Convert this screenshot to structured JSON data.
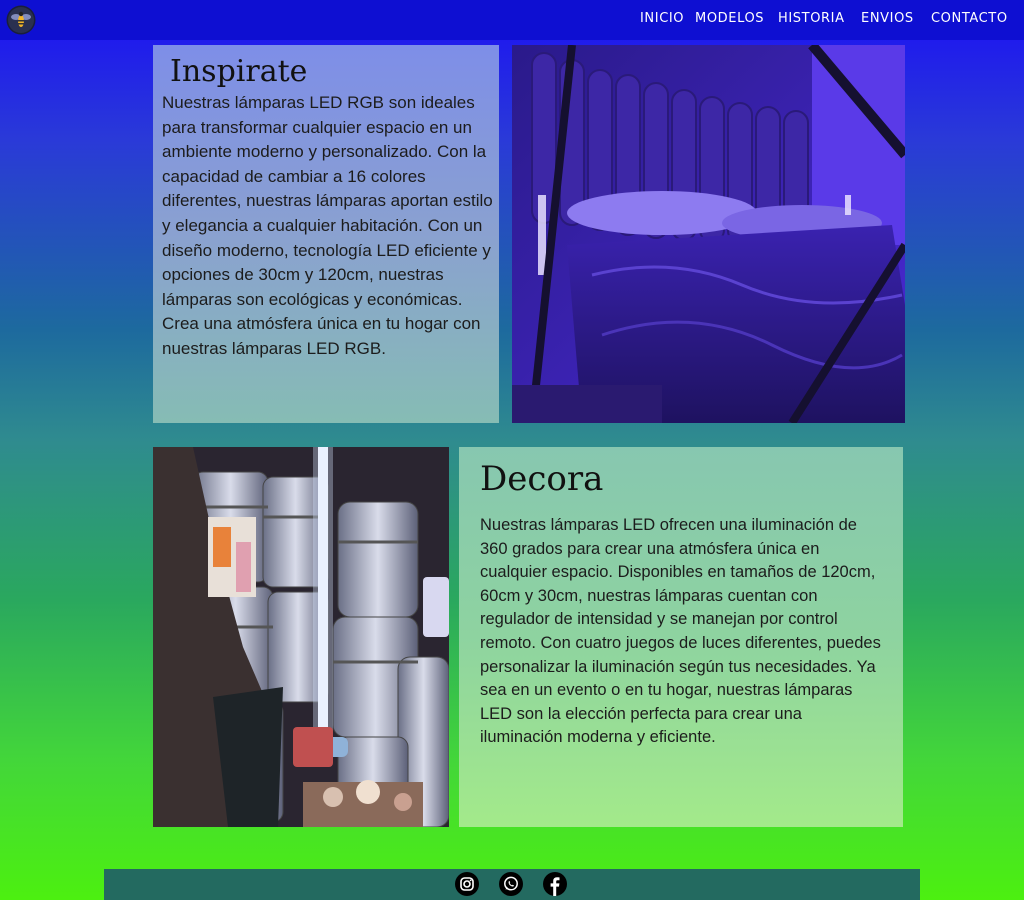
{
  "nav": {
    "logo_icon": "firefly-logo-icon",
    "items": [
      {
        "label": "INICIO"
      },
      {
        "label": "MODELOS"
      },
      {
        "label": "HISTORIA"
      },
      {
        "label": "ENVIOS"
      },
      {
        "label": "CONTACTO"
      }
    ]
  },
  "inspirate": {
    "title": "Inspirate",
    "body": "Nuestras lámparas LED RGB son ideales para transformar cualquier espacio en un ambiente moderno y personalizado. Con la capacidad de cambiar a 16 colores diferentes, nuestras lámparas aportan estilo y elegancia a cualquier habitación. Con un diseño moderno, tecnología LED eficiente y opciones de 30cm y 120cm, nuestras lámparas son ecológicas y económicas. Crea una atmósfera única en tu hogar con nuestras lámparas LED RGB."
  },
  "decora": {
    "title": "Decora",
    "body": "Nuestras lámparas LED ofrecen una iluminación de 360 grados para crear una atmósfera única en cualquier espacio. Disponibles en tamaños de 120cm, 60cm y 30cm, nuestras lámparas cuentan con regulador de intensidad y se manejan por control remoto. Con cuatro juegos de luces diferentes, puedes personalizar la iluminación según tus necesidades. Ya sea en un evento o en tu hogar, nuestras lámparas LED son la elección perfecta para crear una iluminación moderna y eficiente."
  },
  "footer": {
    "icons": [
      "instagram-icon",
      "whatsapp-icon",
      "facebook-icon"
    ]
  },
  "colors": {
    "topbar": "#0e0fd2",
    "footer": "#236a60",
    "gradient_top": "#1b10f4",
    "gradient_bottom": "#4cf010"
  }
}
